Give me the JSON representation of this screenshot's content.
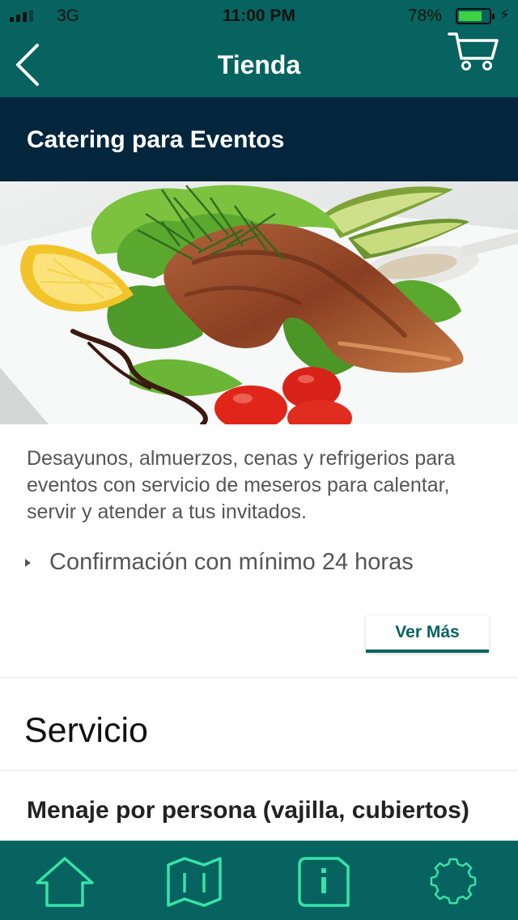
{
  "status_bar": {
    "network": "3G",
    "time": "11:00 PM",
    "battery_percent": "78%",
    "battery_level": 0.78,
    "charging": true
  },
  "nav": {
    "title": "Tienda",
    "back_icon": "chevron-left-icon",
    "cart_icon": "cart-icon"
  },
  "product": {
    "section_title": "Catering para Eventos",
    "hero_image": "grilled-salmon-plate-photo",
    "description": "Desayunos, almuerzos, cenas y refrigerios para eventos con servicio de meseros para calentar, servir y atender a tus invitados.",
    "bullets": [
      "Confirmación con mínimo 24 horas"
    ],
    "more_label": "Ver Más"
  },
  "service": {
    "heading": "Servicio",
    "first_item": "Menaje por persona (vajilla, cubiertos)"
  },
  "tabbar": {
    "items": [
      {
        "name": "home",
        "icon": "home-icon"
      },
      {
        "name": "map",
        "icon": "map-icon"
      },
      {
        "name": "info",
        "icon": "info-icon"
      },
      {
        "name": "settings",
        "icon": "gear-icon"
      }
    ]
  },
  "colors": {
    "header": "#07635f",
    "section_bar": "#03263d",
    "accent": "#07635f",
    "tab_icon": "#37e3a9",
    "battery": "#3fd13f"
  }
}
